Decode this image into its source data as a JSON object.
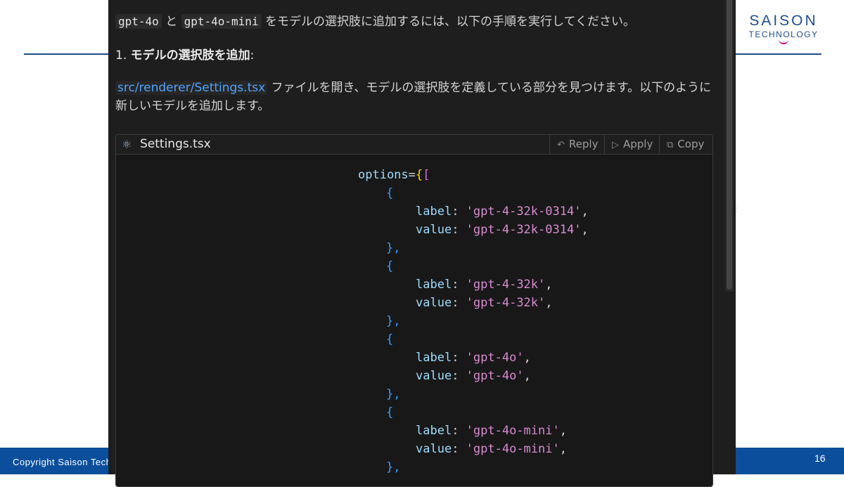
{
  "slide": {
    "logo_line1": "SAISON",
    "logo_line2": "TECHNOLOGY",
    "copyright": "Copyright Saison Technology",
    "page_number": "16"
  },
  "chat": {
    "intro_code1": "gpt-4o",
    "intro_and": " と ",
    "intro_code2": "gpt-4o-mini",
    "intro_rest": " をモデルの選択肢に追加するには、以下の手順を実行してください。",
    "step_number": "1.",
    "step_title": "モデルの選択肢を追加",
    "step_colon": ":",
    "file_path": "src/renderer/Settings.tsx",
    "desc_rest": " ファイルを開き、モデルの選択肢を定義している部分を見つけます。以下のように新しいモデルを追加します。"
  },
  "code_block": {
    "file_name": "Settings.tsx",
    "reply_label": "Reply",
    "apply_label": "Apply",
    "copy_label": "Copy",
    "options_key": "options",
    "options_open": "={[",
    "open_brace": "{",
    "close_brace": "},",
    "label_key": "label",
    "value_key": "value",
    "models": [
      {
        "label": "'gpt-4-32k-0314'",
        "value": "'gpt-4-32k-0314'"
      },
      {
        "label": "'gpt-4-32k'",
        "value": "'gpt-4-32k'"
      },
      {
        "label": "'gpt-4o'",
        "value": "'gpt-4o'"
      },
      {
        "label": "'gpt-4o-mini'",
        "value": "'gpt-4o-mini'"
      }
    ]
  },
  "colors": {
    "accent_blue": "#1f4e8c",
    "footer_blue": "#0b4f9c",
    "logo_smile": "#e4007f",
    "panel_bg": "#1e1e1e",
    "link": "#4fa3ff",
    "string": "#d88bd1"
  },
  "icons": {
    "file_icon": "react-atom-icon",
    "reply_icon": "reply-arrow-icon",
    "apply_icon": "play-icon",
    "copy_icon": "copy-icon"
  }
}
